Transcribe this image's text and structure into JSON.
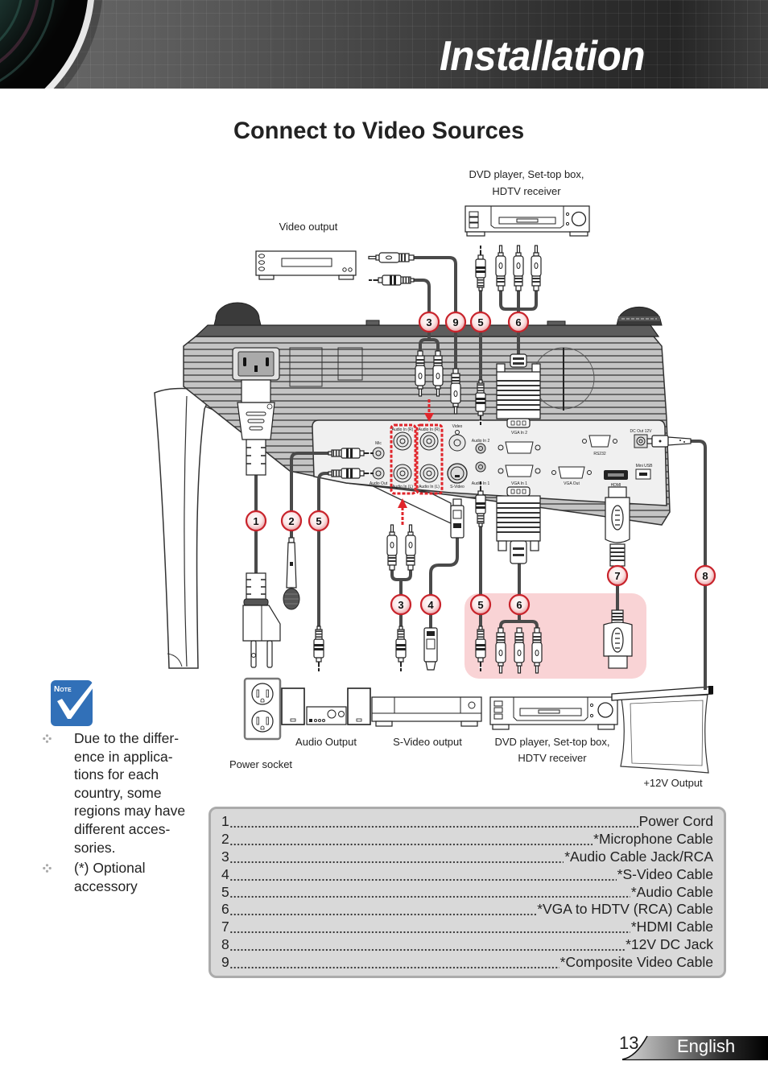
{
  "header": {
    "title": "Installation"
  },
  "page_title": "Connect to Video Sources",
  "diagram": {
    "device_labels": {
      "top_dvd_line1": "DVD player, Set-top box,",
      "top_dvd_line2": "HDTV receiver",
      "video_output": "Video output",
      "audio_output": "Audio Output",
      "svideo_output": "S-Video output",
      "bottom_dvd_line1": "DVD player, Set-top box,",
      "bottom_dvd_line2": "HDTV receiver",
      "power_socket": "Power socket",
      "v12_output": "+12V Output"
    },
    "port_labels": {
      "mic": "Mic",
      "audio_out": "Audio Out",
      "audio_in_r": "Audio In (R)",
      "audio_in_l": "Audio In (L)",
      "video": "Video",
      "svideo": "S-Video",
      "audio_in_2": "Audio In 2",
      "audio_in_1": "Audio In 1",
      "vga_in_2": "VGA In 2",
      "vga_in_1": "VGA In 1",
      "vga_out": "VGA Out",
      "rs232": "RS232",
      "dc_out": "DC Out 12V",
      "mini_usb": "Mini USB",
      "hdmi": "HDMI"
    },
    "callouts": {
      "top": [
        "3",
        "9",
        "5",
        "6"
      ],
      "left": [
        "1",
        "2",
        "5"
      ],
      "right": [
        "7",
        "8"
      ],
      "bottom": [
        "3",
        "4",
        "5",
        "6"
      ]
    },
    "colors": {
      "highlight": "#f9d3d5",
      "callout_ring": "#c8232b",
      "dashed_marker": "#e0252b",
      "cable": "#4a4a4a"
    }
  },
  "note": {
    "icon_label": "Note",
    "icon_color": "#3170b8",
    "bullets": [
      {
        "lines": [
          "Due to the differ-",
          "ence in applica-",
          "tions for each",
          "country, some",
          "regions may have",
          "different acces-",
          "sories."
        ]
      },
      {
        "lines": [
          "(*) Optional",
          "accessory"
        ]
      }
    ]
  },
  "legend": {
    "items": [
      {
        "num": "1",
        "label": "Power Cord"
      },
      {
        "num": "2",
        "label": "*Microphone Cable"
      },
      {
        "num": "3",
        "label": "*Audio Cable Jack/RCA"
      },
      {
        "num": "4",
        "label": "*S-Video Cable"
      },
      {
        "num": "5",
        "label": "*Audio Cable"
      },
      {
        "num": "6",
        "label": "*VGA to HDTV (RCA) Cable"
      },
      {
        "num": "7",
        "label": "*HDMI Cable"
      },
      {
        "num": "8",
        "label": "*12V DC Jack"
      },
      {
        "num": "9",
        "label": "*Composite Video Cable"
      }
    ]
  },
  "footer": {
    "page_number": "13",
    "language": "English"
  }
}
